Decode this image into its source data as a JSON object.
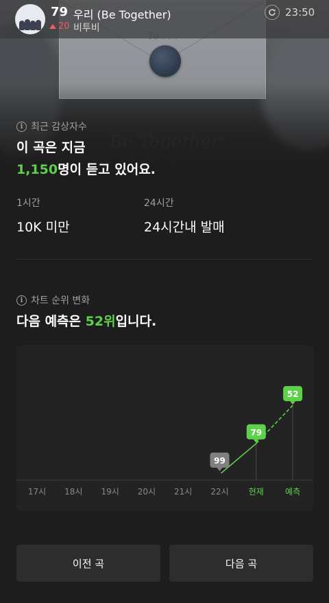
{
  "header": {
    "rank": "79",
    "title": "우리 (Be Together)",
    "rank_change": "20",
    "artist": "비투비",
    "time": "23:50"
  },
  "listeners": {
    "label": "최근 감상자수",
    "line1": "이 곡은 지금",
    "count": "1,150",
    "line2_suffix": "명이 듣고 있어요.",
    "stats": [
      {
        "label": "1시간",
        "value": "10K 미만"
      },
      {
        "label": "24시간",
        "value": "24시간내 발매"
      }
    ]
  },
  "rank_change_section": {
    "label": "차트 순위 변화",
    "prefix": "다음 예측은 ",
    "highlight": "52위",
    "suffix": "입니다."
  },
  "chart_data": {
    "type": "line",
    "categories": [
      "17시",
      "18시",
      "19시",
      "20시",
      "21시",
      "22시",
      "현재",
      "예측"
    ],
    "values": [
      null,
      null,
      null,
      null,
      null,
      99,
      79,
      52
    ],
    "data_labels": [
      "",
      "",
      "",
      "",
      "",
      "99",
      "79",
      "52"
    ],
    "y_axis": "rank (lower is better, inverted)",
    "predicted_segment": "dashed from 현재 to 예측",
    "colors": {
      "line": "#5dd14a",
      "current_badge": "#5dd14a",
      "past_badge": "#808080",
      "highlight_ticks": "#5dd14a"
    }
  },
  "buttons": {
    "prev": "이전 곡",
    "next": "다음 곡"
  },
  "colors": {
    "background": "#1d1d1d",
    "accent_green": "#5dd14a",
    "rank_up": "#f05a6b"
  }
}
